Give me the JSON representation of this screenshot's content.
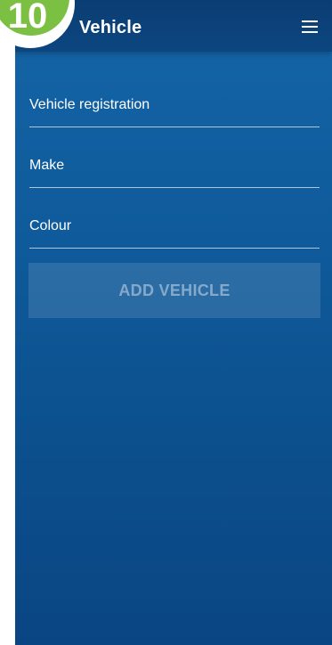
{
  "badge": {
    "number": "10"
  },
  "header": {
    "title": "Vehicle",
    "menu_icon": "hamburger-menu-icon"
  },
  "form": {
    "fields": [
      {
        "label": "Vehicle registration"
      },
      {
        "label": "Make"
      },
      {
        "label": "Colour"
      }
    ],
    "submit_label": "ADD VEHICLE",
    "submit_enabled": false
  },
  "colors": {
    "header_bg": "#0b3d73",
    "body_bg": "#1565a6",
    "badge_green": "#7cc043"
  }
}
